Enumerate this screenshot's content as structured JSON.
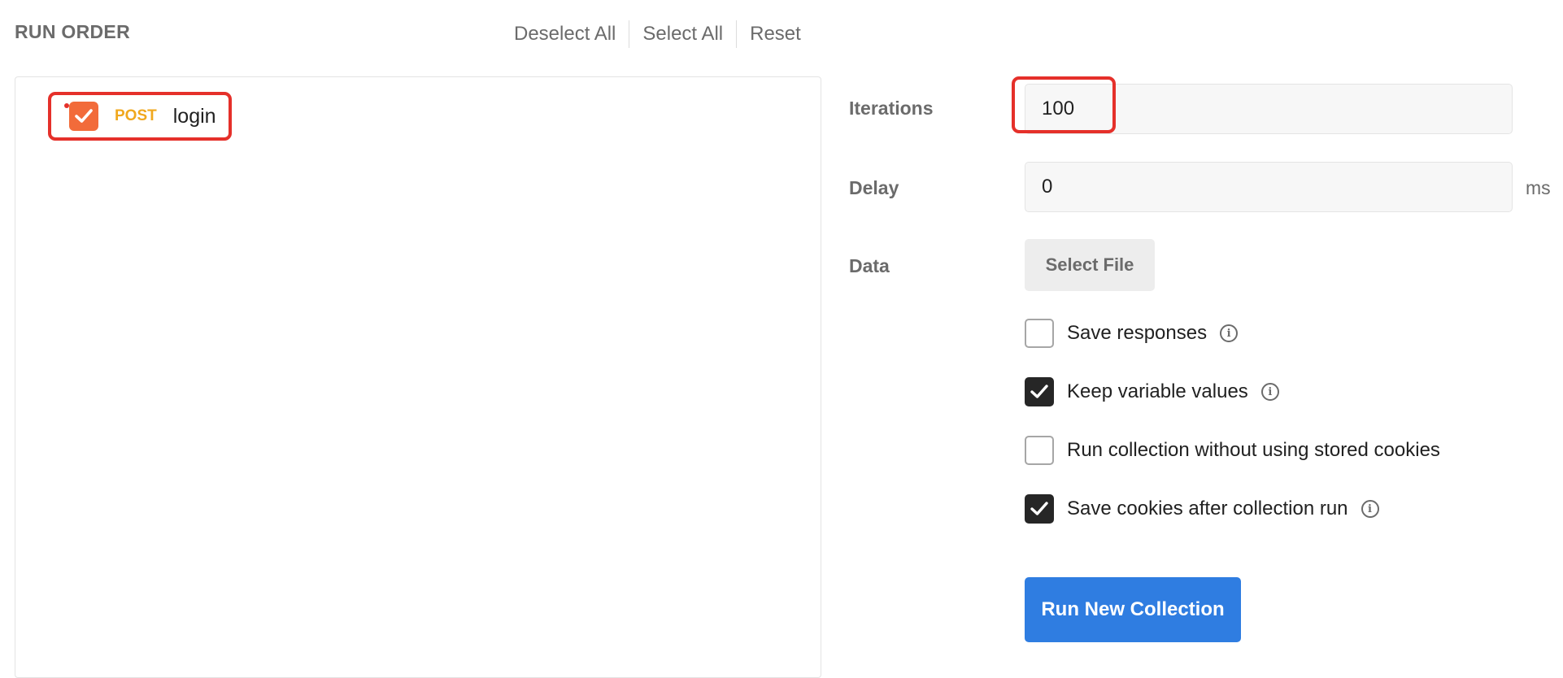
{
  "run_order": {
    "title": "RUN ORDER",
    "deselect_all": "Deselect All",
    "select_all": "Select All",
    "reset": "Reset"
  },
  "requests": [
    {
      "method": "POST",
      "name": "login",
      "checked": true
    }
  ],
  "settings": {
    "iterations": {
      "label": "Iterations",
      "value": "100"
    },
    "delay": {
      "label": "Delay",
      "value": "0",
      "unit": "ms"
    },
    "data": {
      "label": "Data",
      "button": "Select File"
    }
  },
  "options": [
    {
      "label": "Save responses",
      "checked": false,
      "info": true
    },
    {
      "label": "Keep variable values",
      "checked": true,
      "info": true
    },
    {
      "label": "Run collection without using stored cookies",
      "checked": false,
      "info": false
    },
    {
      "label": "Save cookies after collection run",
      "checked": true,
      "info": true
    }
  ],
  "run_button": "Run New Collection",
  "colors": {
    "method_post": "#f0a81e",
    "request_checkbox": "#f26b3a",
    "primary_button": "#2f7de1",
    "highlight": "#e5302a"
  },
  "icons": {
    "check": "check-icon",
    "info": "info-icon"
  }
}
